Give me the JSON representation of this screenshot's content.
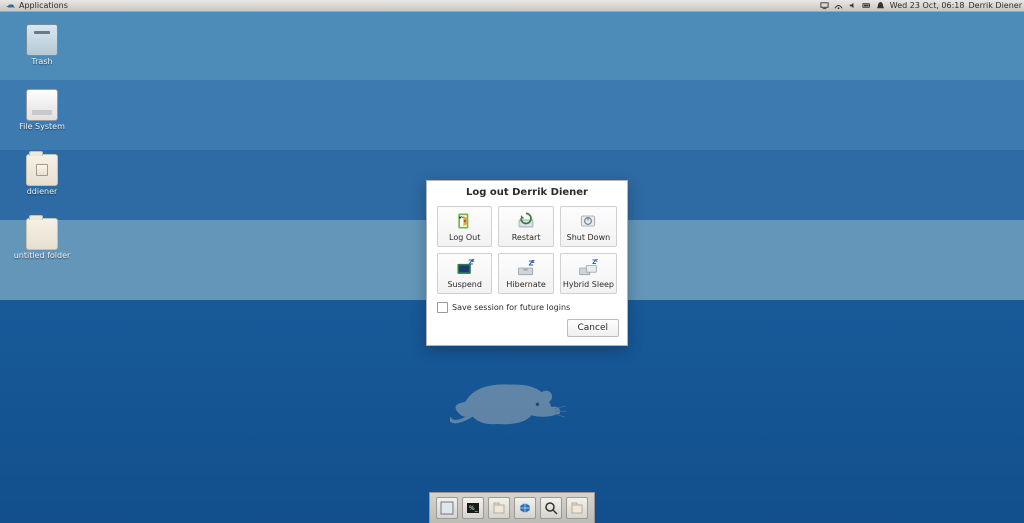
{
  "panel": {
    "applications_label": "Applications",
    "clock": "Wed 23 Oct, 06:18",
    "user": "Derrik Diener"
  },
  "desktop_icons": [
    {
      "id": "trash",
      "label": "Trash"
    },
    {
      "id": "filesystem",
      "label": "File System"
    },
    {
      "id": "home",
      "label": "ddiener"
    },
    {
      "id": "untitled",
      "label": "untitled folder"
    }
  ],
  "dock": {
    "items": [
      {
        "id": "show-desktop"
      },
      {
        "id": "terminal"
      },
      {
        "id": "files"
      },
      {
        "id": "browser"
      },
      {
        "id": "search"
      },
      {
        "id": "folder"
      }
    ]
  },
  "logout_dialog": {
    "title": "Log out Derrik Diener",
    "actions": [
      {
        "id": "logout",
        "label": "Log Out"
      },
      {
        "id": "restart",
        "label": "Restart"
      },
      {
        "id": "shutdown",
        "label": "Shut Down"
      },
      {
        "id": "suspend",
        "label": "Suspend"
      },
      {
        "id": "hibernate",
        "label": "Hibernate"
      },
      {
        "id": "hybrid-sleep",
        "label": "Hybrid Sleep"
      }
    ],
    "save_session_label": "Save session for future logins",
    "save_session_checked": false,
    "cancel_label": "Cancel"
  }
}
